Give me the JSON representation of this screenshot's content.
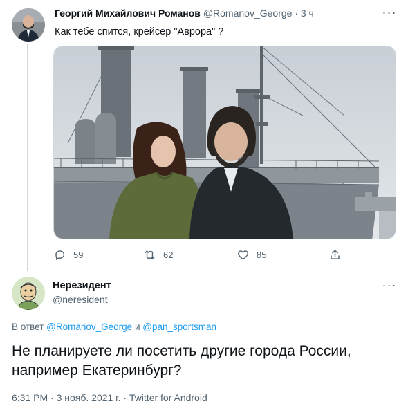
{
  "tweet1": {
    "author_name": "Георгий Михайлович Романов",
    "handle_time": "@Romanov_George · 3 ч",
    "text": "Как тебе спится, крейсер \"Аврора\" ?",
    "more_label": "···",
    "stats": {
      "replies": "59",
      "retweets": "62",
      "likes": "85"
    }
  },
  "tweet2": {
    "author_name": "Нерезидент",
    "handle": "@neresident",
    "more_label": "···",
    "reply_prefix": "В ответ ",
    "reply_user1": "@Romanov_George",
    "reply_and": " и ",
    "reply_user2": "@pan_sportsman",
    "text": "Не планируете ли посетить другие города России, например Екатеринбург?",
    "meta": "6:31 PM · 3 нояб. 2021 г. · Twitter for Android"
  },
  "icons": [
    "reply-icon",
    "retweet-icon",
    "like-icon",
    "share-icon"
  ],
  "colors": {
    "link": "#1d9bf0",
    "secondary_text": "#536471",
    "primary_text": "#0f1419",
    "divider": "#cfd9de"
  }
}
